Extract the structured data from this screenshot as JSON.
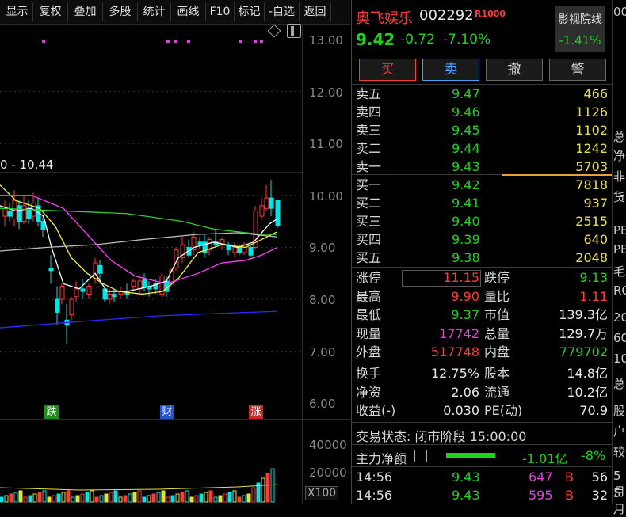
{
  "toolbar": {
    "items": [
      "显示",
      "复权",
      "叠加",
      "多股",
      "统计",
      "画线",
      "F10",
      "标记",
      "-自选",
      "返回"
    ]
  },
  "chart": {
    "ma_label": "0 - 10.44",
    "price_ticks": [
      "13.00",
      "12.00",
      "11.00",
      "10.00",
      "9.00",
      "8.00",
      "7.00",
      "6.00"
    ],
    "volume_ticks": [
      "40000",
      "20000"
    ],
    "volume_unit": "X100",
    "markers": [
      {
        "text": "跌",
        "color": "#1e8e1e"
      },
      {
        "text": "财",
        "color": "#2255cc"
      },
      {
        "text": "涨",
        "color": "#c62828"
      }
    ],
    "colors": {
      "up": "#ff3b3b",
      "down": "#00e5e5",
      "ma5": "#ffffff",
      "ma10": "#f0f040",
      "ma20": "#ff40ff",
      "ma30": "#30d030",
      "ma60": "#2a2aff"
    }
  },
  "quote": {
    "name": "奥飞娱乐",
    "code": "002292",
    "badge": "R1000",
    "price": "9.42",
    "change": "-0.72",
    "change_pct": "-7.10%",
    "sector_name": "影视院线",
    "sector_pct": "-1.41%",
    "buttons": {
      "buy": "买",
      "sell": "卖",
      "cancel": "撤",
      "alert": "警"
    },
    "asks": [
      {
        "label": "卖五",
        "price": "9.47",
        "vol": "466"
      },
      {
        "label": "卖四",
        "price": "9.46",
        "vol": "1126"
      },
      {
        "label": "卖三",
        "price": "9.45",
        "vol": "1102"
      },
      {
        "label": "卖二",
        "price": "9.44",
        "vol": "1242"
      },
      {
        "label": "卖一",
        "price": "9.43",
        "vol": "5703"
      }
    ],
    "bids": [
      {
        "label": "买一",
        "price": "9.42",
        "vol": "7818"
      },
      {
        "label": "买二",
        "price": "9.41",
        "vol": "937"
      },
      {
        "label": "买三",
        "price": "9.40",
        "vol": "2515"
      },
      {
        "label": "买四",
        "price": "9.39",
        "vol": "640"
      },
      {
        "label": "买五",
        "price": "9.38",
        "vol": "2048"
      }
    ],
    "stats": [
      {
        "l1": "涨停",
        "v1": "11.15",
        "c1": "red",
        "l2": "跌停",
        "v2": "9.13",
        "c2": "green"
      },
      {
        "l1": "最高",
        "v1": "9.90",
        "c1": "red",
        "l2": "量比",
        "v2": "1.11",
        "c2": "red"
      },
      {
        "l1": "最低",
        "v1": "9.37",
        "c1": "green",
        "l2": "市值",
        "v2": "139.3亿",
        "c2": "white"
      },
      {
        "l1": "现量",
        "v1": "17742",
        "c1": "magenta",
        "l2": "总量",
        "v2": "129.7万",
        "c2": "white"
      },
      {
        "l1": "外盘",
        "v1": "517748",
        "c1": "red",
        "l2": "内盘",
        "v2": "779702",
        "c2": "green"
      }
    ],
    "stats2": [
      {
        "l1": "换手",
        "v1": "12.75%",
        "l2": "股本",
        "v2": "14.8亿"
      },
      {
        "l1": "净资",
        "v1": "2.06",
        "l2": "流通",
        "v2": "10.2亿"
      },
      {
        "l1": "收益(-)",
        "v1": "0.030",
        "l2": "PE(动)",
        "v2": "70.9"
      }
    ],
    "trade_status": "交易状态: 闭市阶段 15:00:00",
    "main_flow": {
      "label": "主力净额",
      "value": "-1.01亿",
      "pct": "-8%"
    },
    "ticks": [
      {
        "time": "14:56",
        "price": "9.43",
        "vol": "647",
        "side": "B",
        "num": "56"
      },
      {
        "time": "14:56",
        "price": "9.43",
        "vol": "595",
        "side": "B",
        "num": "32"
      }
    ]
  },
  "edge_panel": {
    "chars": [
      "00",
      "总",
      "净",
      "非",
      "货",
      "PE",
      "PE",
      "毛",
      "RO",
      "20",
      "60",
      "10",
      "总",
      "股",
      "户",
      "较",
      "5月",
      "5月"
    ]
  }
}
